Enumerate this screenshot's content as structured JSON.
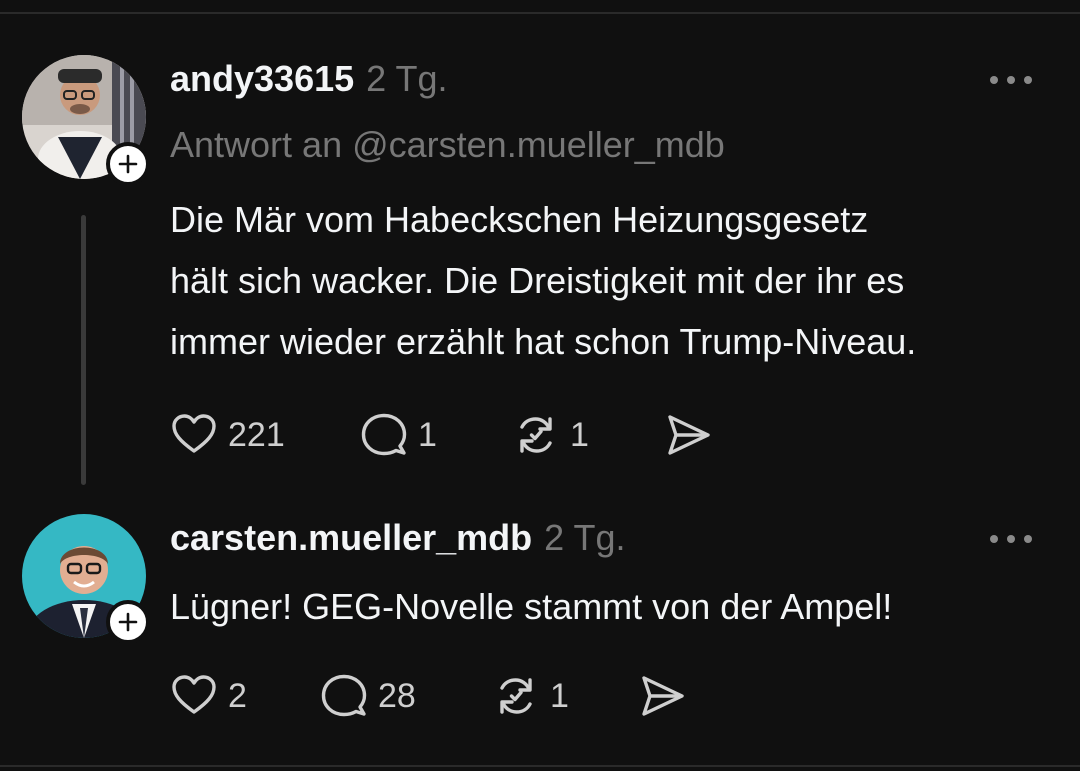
{
  "posts": [
    {
      "username": "andy33615",
      "timestamp": "2 Tg.",
      "reply_to": "Antwort an @carsten.mueller_mdb",
      "body_lines": [
        "Die Mär vom Habeckschen Heizungsgesetz",
        "hält sich wacker. Die Dreistigkeit mit der ihr es",
        "immer wieder erzählt hat schon Trump-Niveau."
      ],
      "likes": "221",
      "comments": "1",
      "reposts": "1",
      "icons": [
        "heart-icon",
        "comment-icon",
        "repost-icon",
        "share-icon",
        "more-icon",
        "plus-icon"
      ]
    },
    {
      "username": "carsten.mueller_mdb",
      "timestamp": "2 Tg.",
      "body_lines": [
        "Lügner! GEG-Novelle stammt von der Ampel!"
      ],
      "likes": "2",
      "comments": "28",
      "reposts": "1",
      "icons": [
        "heart-icon",
        "comment-icon",
        "repost-icon",
        "share-icon",
        "more-icon",
        "plus-icon"
      ]
    }
  ],
  "colors": {
    "background": "#101010",
    "primary_text": "#f3f5f7",
    "secondary_text": "#777777",
    "icon": "#cfcfcf"
  }
}
